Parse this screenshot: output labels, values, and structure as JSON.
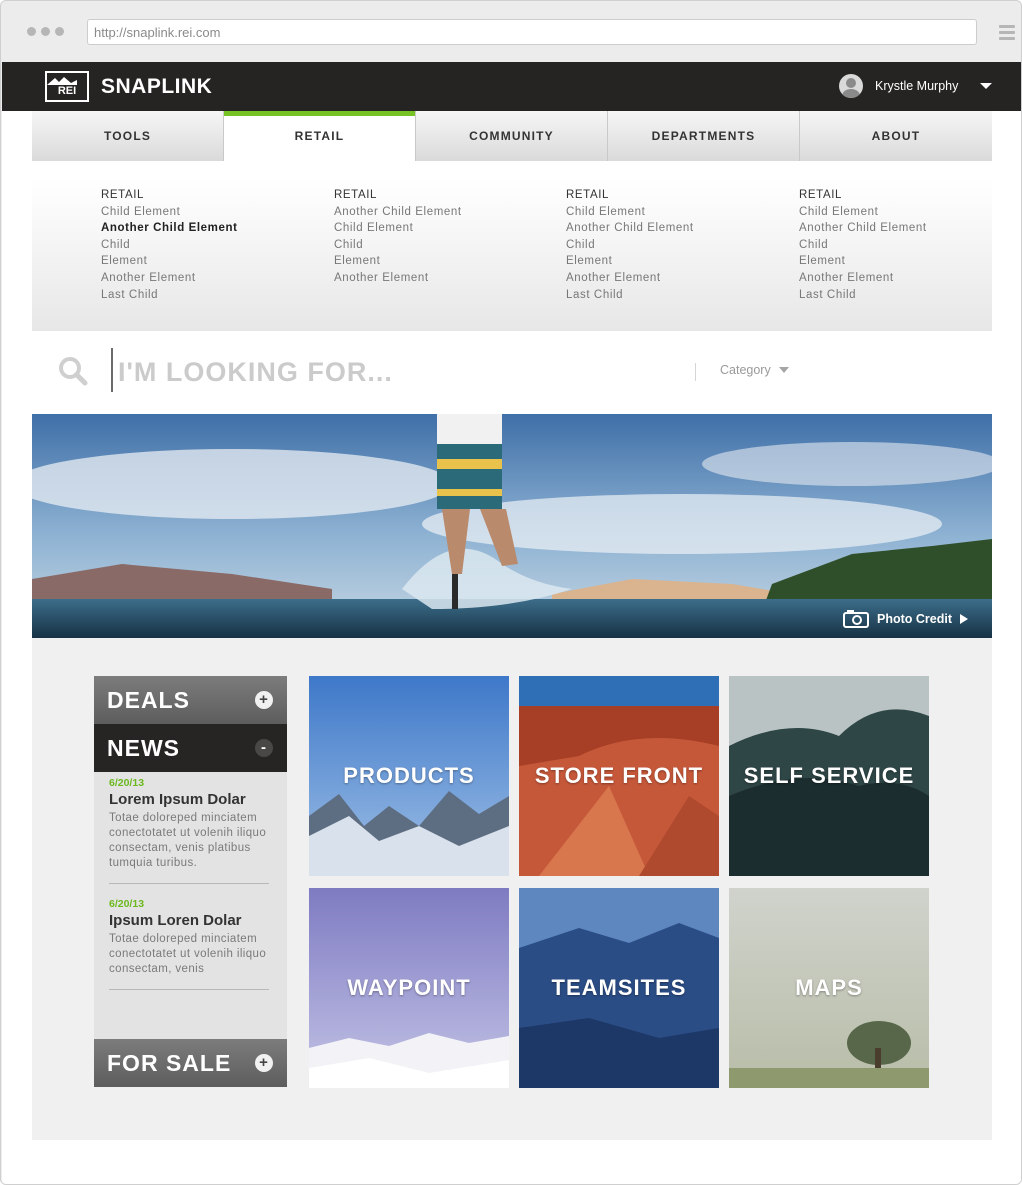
{
  "browser": {
    "url": "http://snaplink.rei.com"
  },
  "header": {
    "logo_text": "REI",
    "brand": "SNAPLINK",
    "user_name": "Krystle Murphy"
  },
  "nav": {
    "tabs": [
      {
        "label": "TOOLS",
        "active": false
      },
      {
        "label": "RETAIL",
        "active": true
      },
      {
        "label": "COMMUNITY",
        "active": false
      },
      {
        "label": "DEPARTMENTS",
        "active": false
      },
      {
        "label": "ABOUT",
        "active": false
      }
    ]
  },
  "mega_menu": {
    "columns": [
      {
        "heading": "RETAIL",
        "items": [
          "Child Element",
          "Another Child Element",
          "Child",
          "Element",
          "Another Element",
          "Last Child"
        ],
        "bold_item": "Another Child Element"
      },
      {
        "heading": "RETAIL",
        "items": [
          "Another Child Element",
          "Child Element",
          "Child",
          "Element",
          "Another Element"
        ]
      },
      {
        "heading": "RETAIL",
        "items": [
          "Child Element",
          "Another Child Element",
          "Child",
          "Element",
          "Another Element",
          "Last Child"
        ]
      },
      {
        "heading": "RETAIL",
        "items": [
          "Child Element",
          "Another Child Element",
          "Child",
          "Element",
          "Another Element",
          "Last Child"
        ]
      }
    ]
  },
  "search": {
    "placeholder": "I'M LOOKING FOR...",
    "category_label": "Category"
  },
  "hero": {
    "photo_credit": "Photo Credit"
  },
  "accordion": {
    "deals": {
      "label": "DEALS",
      "toggle": "+"
    },
    "news": {
      "label": "NEWS",
      "toggle": "-",
      "items": [
        {
          "date": "6/20/13",
          "title": "Lorem Ipsum Dolar",
          "text": "Totae doloreped minciatem conectotatet ut volenih iliquo consectam, venis platibus tumquia turibus."
        },
        {
          "date": "6/20/13",
          "title": "Ipsum Loren Dolar",
          "text": "Totae doloreped minciatem conectotatet ut volenih iliquo consectam, venis"
        }
      ]
    },
    "for_sale": {
      "label": "FOR SALE",
      "toggle": "+"
    }
  },
  "tiles": [
    {
      "label": "PRODUCTS"
    },
    {
      "label": "STORE FRONT"
    },
    {
      "label": "SELF SERVICE"
    },
    {
      "label": "WAYPOINT"
    },
    {
      "label": "TEAMSITES"
    },
    {
      "label": "MAPS"
    }
  ],
  "colors": {
    "accent_green": "#77c225",
    "date_green": "#6cb91f",
    "topbar": "#262422",
    "accordion_dark": "#272523"
  }
}
